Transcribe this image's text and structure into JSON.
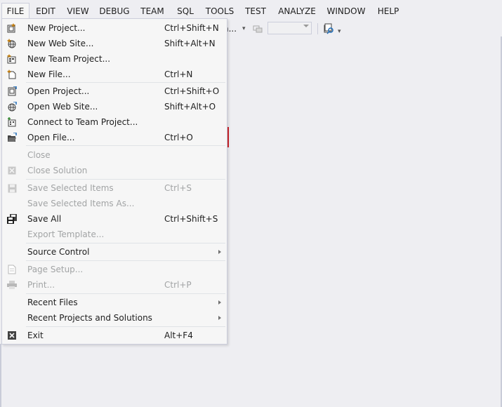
{
  "menubar": {
    "items": [
      {
        "label": "FILE"
      },
      {
        "label": "EDIT"
      },
      {
        "label": "VIEW"
      },
      {
        "label": "DEBUG"
      },
      {
        "label": "TEAM"
      },
      {
        "label": "SQL"
      },
      {
        "label": "TOOLS"
      },
      {
        "label": "TEST"
      },
      {
        "label": "ANALYZE"
      },
      {
        "label": "WINDOW"
      },
      {
        "label": "HELP"
      }
    ]
  },
  "toolbar": {
    "truncated_text": "h...",
    "combo_value": ""
  },
  "file_menu": {
    "items": [
      {
        "label": "New Project...",
        "shortcut": "Ctrl+Shift+N",
        "icon": "new-project-icon"
      },
      {
        "label": "New Web Site...",
        "shortcut": "Shift+Alt+N",
        "icon": "new-website-icon"
      },
      {
        "label": "New Team Project...",
        "shortcut": "",
        "icon": "new-team-project-icon"
      },
      {
        "label": "New File...",
        "shortcut": "Ctrl+N",
        "icon": "new-file-icon"
      },
      {
        "label": "Open Project...",
        "shortcut": "Ctrl+Shift+O",
        "icon": "open-project-icon"
      },
      {
        "label": "Open Web Site...",
        "shortcut": "Shift+Alt+O",
        "icon": "open-website-icon"
      },
      {
        "label": "Connect to Team Project...",
        "shortcut": "",
        "icon": "connect-team-icon"
      },
      {
        "label": "Open File...",
        "shortcut": "Ctrl+O",
        "icon": "open-file-icon"
      },
      {
        "label": "Close",
        "shortcut": "",
        "icon": ""
      },
      {
        "label": "Close Solution",
        "shortcut": "",
        "icon": "close-solution-icon"
      },
      {
        "label": "Save Selected Items",
        "shortcut": "Ctrl+S",
        "icon": "save-icon"
      },
      {
        "label": "Save Selected Items As...",
        "shortcut": "",
        "icon": ""
      },
      {
        "label": "Save All",
        "shortcut": "Ctrl+Shift+S",
        "icon": "save-all-icon"
      },
      {
        "label": "Export Template...",
        "shortcut": "",
        "icon": ""
      },
      {
        "label": "Source Control",
        "shortcut": "",
        "icon": ""
      },
      {
        "label": "Page Setup...",
        "shortcut": "",
        "icon": "page-setup-icon"
      },
      {
        "label": "Print...",
        "shortcut": "Ctrl+P",
        "icon": "print-icon"
      },
      {
        "label": "Recent Files",
        "shortcut": "",
        "icon": ""
      },
      {
        "label": "Recent Projects and Solutions",
        "shortcut": "",
        "icon": ""
      },
      {
        "label": "Exit",
        "shortcut": "Alt+F4",
        "icon": "exit-icon"
      }
    ]
  },
  "colors": {
    "highlight_border": "#D2232A",
    "menu_background": "#F6F6F6",
    "disabled_text": "#A2A4A5",
    "ide_background": "#EEEEF2"
  }
}
